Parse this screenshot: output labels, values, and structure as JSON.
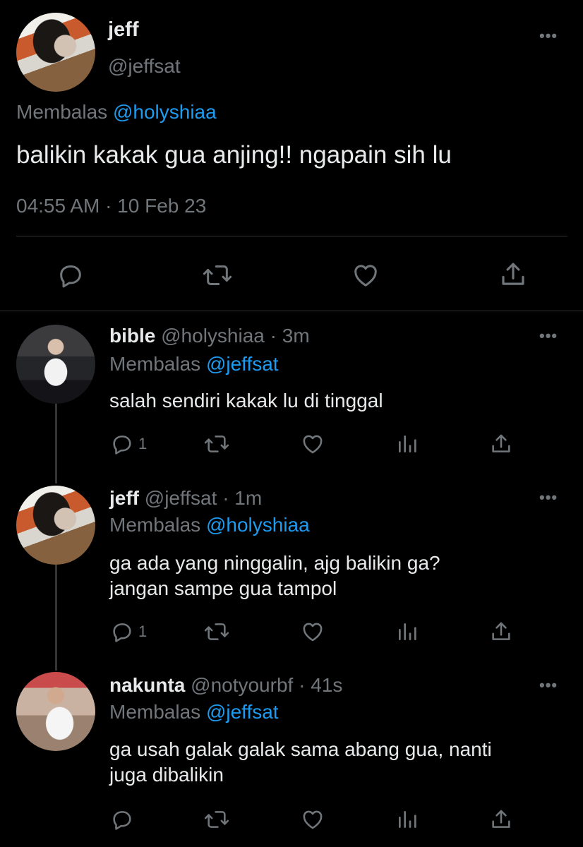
{
  "main_tweet": {
    "name": "jeff",
    "handle": "@jeffsat",
    "replying_prefix": "Membalas",
    "replying_to": "@holyshiaa",
    "text": "balikin kakak gua anjing!! ngapain sih lu",
    "timestamp": "04:55 AM · 10 Feb 23",
    "actions": [
      "reply-icon",
      "retweet-icon",
      "like-icon",
      "share-icon"
    ]
  },
  "replies": [
    {
      "name": "bible",
      "handle": "@holyshiaa",
      "time": "· 3m",
      "replying_prefix": "Membalas",
      "replying_to": "@jeffsat",
      "text_lines": [
        "salah sendiri kakak lu di tinggal"
      ],
      "reply_count": "1"
    },
    {
      "name": "jeff",
      "handle": "@jeffsat",
      "time": "· 1m",
      "replying_prefix": "Membalas",
      "replying_to": "@holyshiaa",
      "text_lines": [
        "ga ada yang ninggalin, ajg balikin ga?",
        "jangan sampe gua tampol"
      ],
      "reply_count": "1"
    },
    {
      "name": "nakunta",
      "handle": "@notyourbf",
      "time": "· 41s",
      "replying_prefix": "Membalas",
      "replying_to": "@jeffsat",
      "text_lines": [
        "ga usah galak galak sama abang gua, nanti",
        "juga dibalikin"
      ],
      "reply_count": ""
    }
  ],
  "colors": {
    "background": "#000000",
    "text": "#e7e9ea",
    "secondary": "#71767b",
    "link": "#1d9bf0",
    "divider": "#2f3336"
  }
}
